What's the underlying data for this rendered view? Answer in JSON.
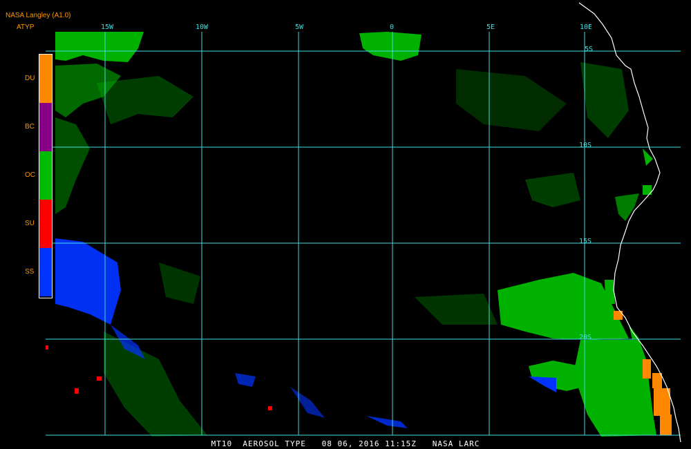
{
  "header": {
    "source": "NASA Langley (A1.0)",
    "product": "ATYP"
  },
  "legend": [
    {
      "code": "DU",
      "color": "#ff8800"
    },
    {
      "code": "BC",
      "color": "#880088"
    },
    {
      "code": "OC",
      "color": "#00bb00"
    },
    {
      "code": "SU",
      "color": "#ff0000"
    },
    {
      "code": "SS",
      "color": "#0033ff"
    }
  ],
  "grid": {
    "lon_labels": [
      "15W",
      "10W",
      "5W",
      "0",
      "5E",
      "10E"
    ],
    "lat_labels": [
      "5S",
      "10S",
      "15S",
      "20S"
    ],
    "line_color": "#40e0e0"
  },
  "footer": "MT10  AEROSOL TYPE   08 06, 2016 11:15Z   NASA LARC",
  "colors": {
    "background": "#000000",
    "coastline": "#ffffff",
    "header_text": "#ff9900"
  }
}
